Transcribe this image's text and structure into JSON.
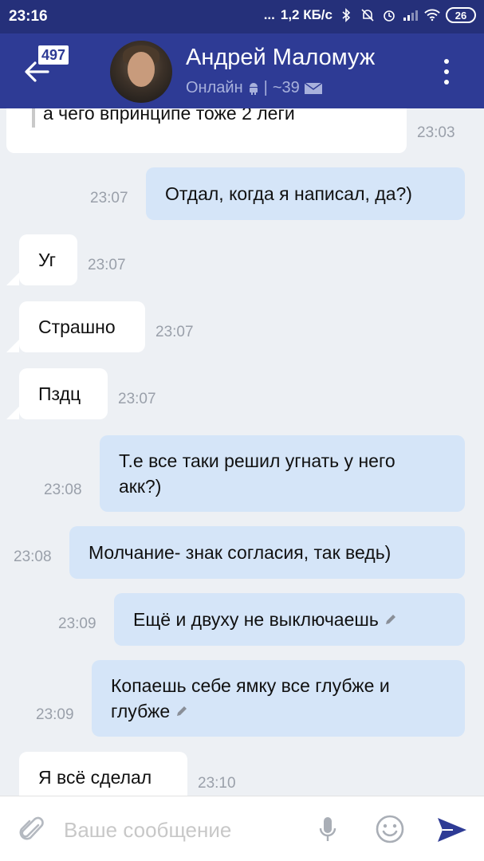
{
  "status_bar": {
    "time": "23:16",
    "dots": "...",
    "net_speed": "1,2 КБ/с",
    "battery": "26"
  },
  "header": {
    "unread_count": "497",
    "contact_name": "Андрей Маломуж",
    "status_text": "Онлайн",
    "separator": "|",
    "messages_count": "~39"
  },
  "messages": [
    {
      "direction": "in",
      "text": "а чего впринципе тоже 2 леги",
      "time": "23:03",
      "quoted": true,
      "edited": false
    },
    {
      "direction": "out",
      "text": "Отдал, когда я написал, да?)",
      "time": "23:07",
      "edited": false
    },
    {
      "direction": "in",
      "text": "Уг",
      "time": "23:07",
      "edited": false
    },
    {
      "direction": "in",
      "text": "Страшно",
      "time": "23:07",
      "edited": false
    },
    {
      "direction": "in",
      "text": "Пздц",
      "time": "23:07",
      "edited": false
    },
    {
      "direction": "out",
      "text_line1": "Т.е все таки решил угнать у него",
      "text_line2": "акк?)",
      "time": "23:08",
      "edited": false
    },
    {
      "direction": "out",
      "text": "Молчание- знак согласия, так ведь)",
      "time": "23:08",
      "edited": false
    },
    {
      "direction": "out",
      "text": "Ещё и двуху не выключаешь",
      "time": "23:09",
      "edited": true
    },
    {
      "direction": "out",
      "text_line1": "Копаешь себе ямку все глубже и",
      "text_line2": "глубже",
      "time": "23:09",
      "edited": true
    },
    {
      "direction": "in",
      "text": "Я всё сделал",
      "time": "23:10",
      "edited": false
    }
  ],
  "input": {
    "placeholder": "Ваше сообщение",
    "value": ""
  },
  "colors": {
    "status_bar": "#25307a",
    "app_bar": "#2e3b95",
    "chat_background": "#edf0f4",
    "incoming_bubble": "#ffffff",
    "outgoing_bubble": "#d5e5f8",
    "send_icon": "#2e3b95"
  },
  "icons": {
    "back": "arrow-left-icon",
    "menu": "more-vertical-icon",
    "attach": "paperclip-icon",
    "mic": "microphone-icon",
    "emoji": "smiley-icon",
    "send": "send-icon",
    "platform": "android-icon",
    "mail": "envelope-icon",
    "edited": "pencil-icon"
  }
}
